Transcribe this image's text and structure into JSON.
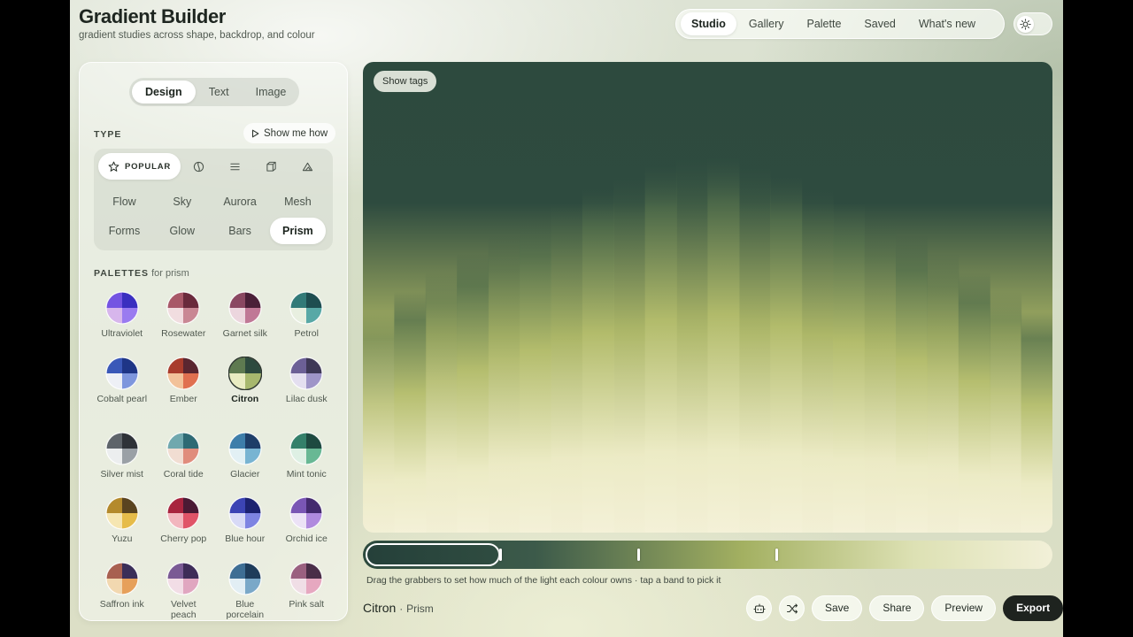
{
  "header": {
    "title": "Gradient Builder",
    "subtitle": "gradient studies across shape, backdrop, and colour",
    "nav": [
      "Studio",
      "Gallery",
      "Palette",
      "Saved",
      "What's new"
    ],
    "nav_active": "Studio",
    "theme_icon": "sun-icon"
  },
  "sidebar": {
    "mode_tabs": [
      "Design",
      "Text",
      "Image"
    ],
    "mode_active": "Design",
    "type_label": "TYPE",
    "show_me_how": "Show me how",
    "filters": {
      "popular_label": "POPULAR",
      "icons": [
        "star-icon",
        "leaf-icon",
        "lines-icon",
        "cube-icon",
        "mountain-icon"
      ]
    },
    "types": [
      "Flow",
      "Sky",
      "Aurora",
      "Mesh",
      "Forms",
      "Glow",
      "Bars",
      "Prism"
    ],
    "type_active": "Prism",
    "palettes_label": "PALETTES",
    "palettes_suffix": "for prism",
    "palettes": [
      {
        "name": "Ultraviolet",
        "colors": [
          "#3a2fc0",
          "#9a7bf0",
          "#d7b6ec",
          "#7454e2"
        ]
      },
      {
        "name": "Rosewater",
        "colors": [
          "#6a2a3c",
          "#c98794",
          "#f1dde0",
          "#a85868"
        ]
      },
      {
        "name": "Garnet silk",
        "colors": [
          "#4a2038",
          "#c07896",
          "#ecd6de",
          "#8a4862"
        ]
      },
      {
        "name": "Petrol",
        "colors": [
          "#1e4d50",
          "#58a8a6",
          "#e8efe0",
          "#327a78"
        ]
      },
      {
        "name": "Cobalt pearl",
        "colors": [
          "#1e3586",
          "#7e96dd",
          "#eef0f6",
          "#3a58b8"
        ]
      },
      {
        "name": "Ember",
        "colors": [
          "#5a2630",
          "#e07050",
          "#f2c29a",
          "#a83c2c"
        ]
      },
      {
        "name": "Citron",
        "colors": [
          "#2d4a3e",
          "#a7b86e",
          "#e9ecc2",
          "#5e7a50"
        ]
      },
      {
        "name": "Lilac dusk",
        "colors": [
          "#3e3856",
          "#9f95c8",
          "#e4dff0",
          "#6c6096"
        ]
      },
      {
        "name": "Silver mist",
        "colors": [
          "#2e3238",
          "#9aa0a6",
          "#eceeef",
          "#5e646a"
        ]
      },
      {
        "name": "Coral tide",
        "colors": [
          "#2e6a74",
          "#e08c7c",
          "#f1ddd2",
          "#70a8ae"
        ]
      },
      {
        "name": "Glacier",
        "colors": [
          "#1e3e68",
          "#78b4d2",
          "#e2f0f4",
          "#3e7eaa"
        ]
      },
      {
        "name": "Mint tonic",
        "colors": [
          "#1e4a40",
          "#68b894",
          "#def0e4",
          "#34806a"
        ]
      },
      {
        "name": "Yuzu",
        "colors": [
          "#5a4420",
          "#e6bc4a",
          "#f6e6b2",
          "#b48a2c"
        ]
      },
      {
        "name": "Cherry pop",
        "colors": [
          "#4a1a34",
          "#e05468",
          "#f2b6be",
          "#a8243e"
        ]
      },
      {
        "name": "Blue hour",
        "colors": [
          "#1c2270",
          "#7e84e2",
          "#d8daf6",
          "#3c44b4"
        ]
      },
      {
        "name": "Orchid ice",
        "colors": [
          "#442a6e",
          "#b08ade",
          "#ece2f6",
          "#7a56b4"
        ]
      },
      {
        "name": "Saffron ink",
        "colors": [
          "#3a2e58",
          "#e6a05a",
          "#f2d8b0",
          "#a86050"
        ]
      },
      {
        "name": "Velvet peach",
        "colors": [
          "#3e2c58",
          "#e0a6c0",
          "#f2dde6",
          "#7a5a94"
        ]
      },
      {
        "name": "Blue porcelain",
        "colors": [
          "#1e3c5a",
          "#7aa8c8",
          "#e2eef4",
          "#3e6e94"
        ]
      },
      {
        "name": "Pink salt",
        "colors": [
          "#4a2e48",
          "#e6a8c0",
          "#f0dee6",
          "#9a6080"
        ]
      }
    ],
    "palette_active": "Citron"
  },
  "canvas": {
    "show_tags": "Show tags"
  },
  "stops": {
    "grabbers": [
      0.2,
      0.4,
      0.6
    ],
    "hint": "Drag the grabbers to set how much of the light each colour owns · tap a band to pick it"
  },
  "footer": {
    "name": "Citron",
    "sep": "·",
    "type": "Prism",
    "icons": [
      "robot-icon",
      "shuffle-icon"
    ],
    "actions": [
      "Save",
      "Share",
      "Preview",
      "Export"
    ]
  },
  "colors": {
    "canvas_top": "#2d4a3e",
    "canvas_mid": "#a5b063",
    "canvas_bottom": "#f1eed3",
    "primary_button": "#1e231f"
  }
}
